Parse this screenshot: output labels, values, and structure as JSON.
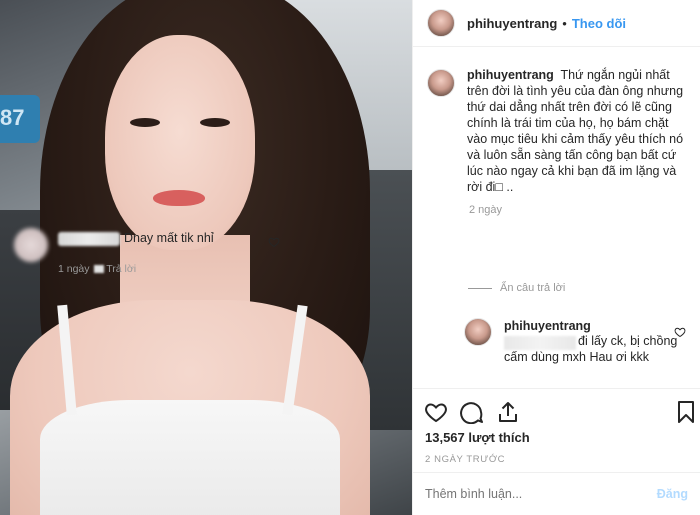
{
  "post": {
    "photo_alt": "photo",
    "sign_text": "87"
  },
  "header": {
    "username": "phihuyentrang",
    "separator": "•",
    "follow_label": "Theo dõi"
  },
  "caption": {
    "username": "phihuyentrang",
    "text": "Thứ ngắn ngủi nhất trên đời là tình yêu của đàn ông nhưng thứ dai dẳng nhất trên đời có lẽ cũng chính là trái tim của họ, họ bám chặt vào mục tiêu khi cảm thấy yêu thích nó và luôn sẵn sàng tấn công bạn bất cứ lúc nào ngay cả khi bạn đã im lặng và rời đi□ ..",
    "time": "2 ngày"
  },
  "comment": {
    "text": "Dnay mất tik nhỉ",
    "time": "1 ngày",
    "reply_label": "Trả lời"
  },
  "hide_replies_label": "Ẩn câu trả lời",
  "reply": {
    "username": "phihuyentrang",
    "text": "đi lấy ck, bị chồng cấm dùng mxh Hau ơi kkk"
  },
  "actions": {
    "like_icon": "heart-icon",
    "comment_icon": "comment-icon",
    "share_icon": "share-icon",
    "save_icon": "bookmark-icon"
  },
  "likes_text": "13,567 lượt thích",
  "posted_ago": "2 NGÀY TRƯỚC",
  "comment_box": {
    "placeholder": "Thêm bình luận...",
    "post_label": "Đăng"
  },
  "colors": {
    "link_blue": "#3897f0",
    "post_disabled": "#b3dbff",
    "muted": "#999999"
  }
}
